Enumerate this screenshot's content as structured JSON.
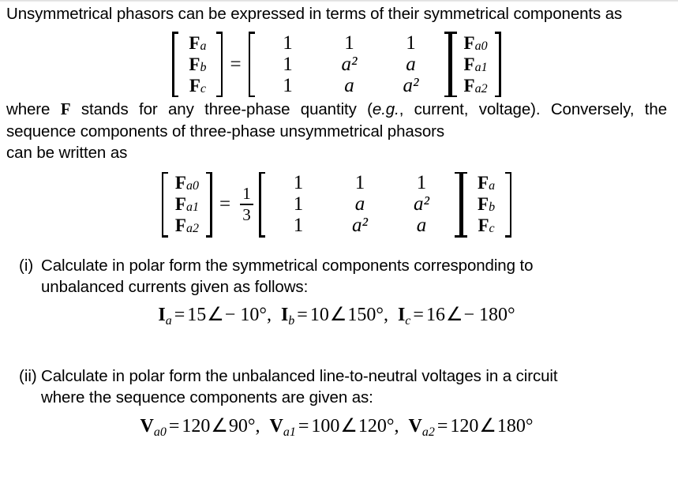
{
  "document": {
    "intro": {
      "line": "Unsymmetrical phasors can be expressed in terms of their symmetrical components as"
    },
    "equation_1": {
      "lhs_vector": [
        "F_a",
        "F_b",
        "F_c"
      ],
      "lhs_items": [
        {
          "sym": "F",
          "sub": "a"
        },
        {
          "sym": "F",
          "sub": "b"
        },
        {
          "sym": "F",
          "sub": "c"
        }
      ],
      "equals": "=",
      "matrix_rows": [
        [
          "1",
          "1",
          "1"
        ],
        [
          "1",
          "a²",
          "a"
        ],
        [
          "1",
          "a",
          "a²"
        ]
      ],
      "rhs_items": [
        {
          "sym": "F",
          "sub": "a0"
        },
        {
          "sym": "F",
          "sub": "a1"
        },
        {
          "sym": "F",
          "sub": "a2"
        }
      ]
    },
    "middle": {
      "text_before_F": "where ",
      "bold_F": "F",
      "text_after_F": " stands for any three-phase quantity (",
      "italic_eg": "e.g.",
      "text_tail": ", current, voltage). Conversely, the sequence components of three-phase unsymmetrical phasors",
      "last_line": "can be written as"
    },
    "equation_2": {
      "lhs_items": [
        {
          "sym": "F",
          "sub": "a0"
        },
        {
          "sym": "F",
          "sub": "a1"
        },
        {
          "sym": "F",
          "sub": "a2"
        }
      ],
      "equals": "=",
      "fraction": {
        "numerator": "1",
        "denominator": "3"
      },
      "matrix_rows": [
        [
          "1",
          "1",
          "1"
        ],
        [
          "1",
          "a",
          "a²"
        ],
        [
          "1",
          "a²",
          "a"
        ]
      ],
      "rhs_items": [
        {
          "sym": "F",
          "sub": "a"
        },
        {
          "sym": "F",
          "sub": "b"
        },
        {
          "sym": "F",
          "sub": "c"
        }
      ]
    },
    "items": [
      {
        "label": "(i)",
        "text_line1": "Calculate in polar form the symmetrical components corresponding to",
        "text_line2": "unbalanced currents given as follows:",
        "math": {
          "terms": [
            {
              "sym": "I",
              "sub": "a",
              "value": "15",
              "angle": "− 10°"
            },
            {
              "sym": "I",
              "sub": "b",
              "value": "10",
              "angle": "150°"
            },
            {
              "sym": "I",
              "sub": "c",
              "value": "16",
              "angle": "− 180°"
            }
          ]
        }
      },
      {
        "label": "(ii)",
        "text_line1": "Calculate in polar form the unbalanced line-to-neutral voltages in a circuit",
        "text_line2": "where the sequence components are given as:",
        "math": {
          "terms": [
            {
              "sym": "V",
              "sub": "a0",
              "value": "120",
              "angle": "90°"
            },
            {
              "sym": "V",
              "sub": "a1",
              "value": "100",
              "angle": "120°"
            },
            {
              "sym": "V",
              "sub": "a2",
              "value": "120",
              "angle": "180°"
            }
          ]
        }
      }
    ],
    "symbols": {
      "angle": "∠",
      "equals": "=",
      "comma": ",",
      "degree": "°"
    }
  }
}
